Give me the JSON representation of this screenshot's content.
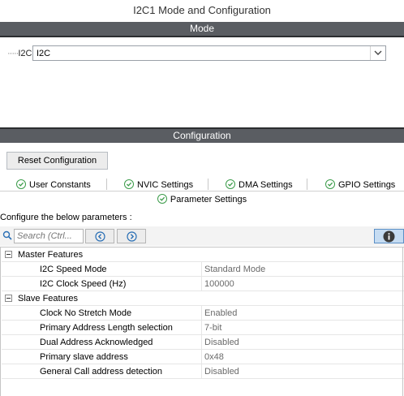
{
  "window": {
    "title": "I2C1 Mode and Configuration"
  },
  "mode_section": {
    "header": "Mode",
    "i2c_label": "I2C",
    "i2c_value": "I2C"
  },
  "config_section": {
    "header": "Configuration",
    "reset_button": "Reset Configuration",
    "tabs": [
      {
        "label": "User Constants"
      },
      {
        "label": "NVIC Settings"
      },
      {
        "label": "DMA Settings"
      },
      {
        "label": "GPIO Settings"
      }
    ],
    "active_tab": "Parameter Settings",
    "instructions": "Configure the below parameters :",
    "search_placeholder": "Search (Ctrl...",
    "groups": [
      {
        "name": "Master Features",
        "params": [
          {
            "name": "I2C Speed Mode",
            "value": "Standard Mode"
          },
          {
            "name": "I2C Clock Speed (Hz)",
            "value": "100000"
          }
        ]
      },
      {
        "name": "Slave Features",
        "params": [
          {
            "name": "Clock No Stretch Mode",
            "value": "Enabled"
          },
          {
            "name": "Primary Address Length selection",
            "value": "7-bit"
          },
          {
            "name": "Dual Address Acknowledged",
            "value": "Disabled"
          },
          {
            "name": "Primary slave address",
            "value": "0x48"
          },
          {
            "name": "General Call address detection",
            "value": "Disabled"
          }
        ]
      }
    ]
  },
  "colors": {
    "header_bar": "#5a5d62",
    "check_green": "#3c9c4a",
    "info_button": "#c6dcf2"
  }
}
